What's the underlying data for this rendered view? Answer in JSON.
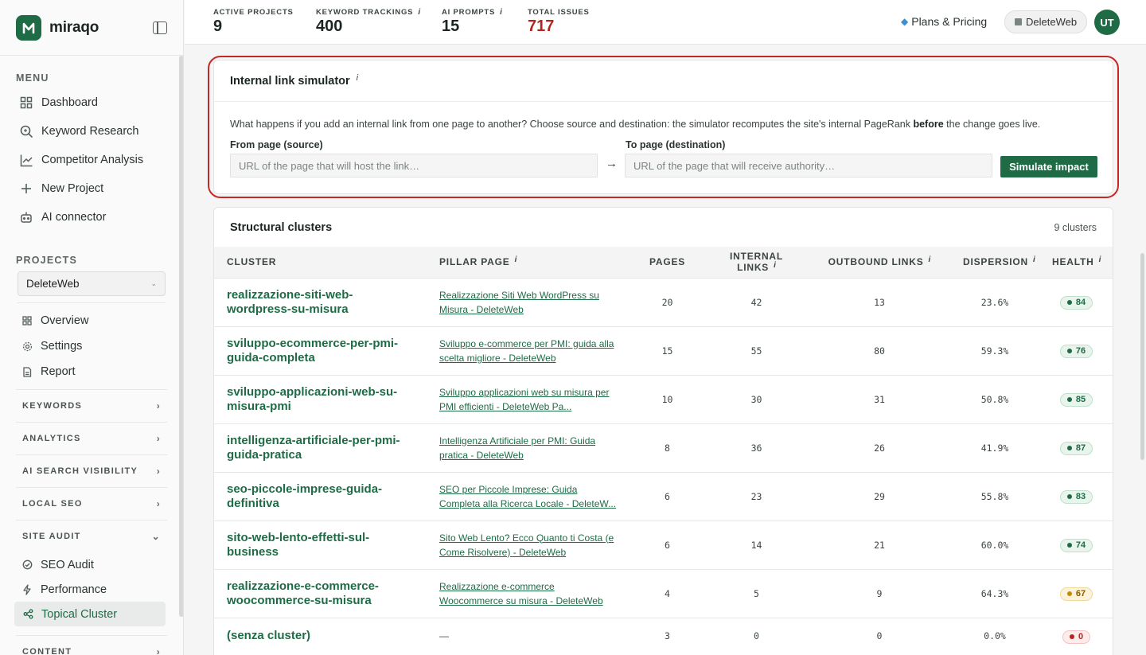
{
  "brand": {
    "name": "miraqo"
  },
  "sidebar": {
    "menu_label": "MENU",
    "menu": [
      {
        "label": "Dashboard",
        "icon": "grid-icon"
      },
      {
        "label": "Keyword Research",
        "icon": "search-icon"
      },
      {
        "label": "Competitor Analysis",
        "icon": "chart-line-icon"
      },
      {
        "label": "New Project",
        "icon": "plus-icon"
      },
      {
        "label": "AI connector",
        "icon": "robot-icon"
      }
    ],
    "projects_label": "PROJECTS",
    "project_select": "DeleteWeb",
    "project_items": [
      {
        "label": "Overview",
        "icon": "grid-icon"
      },
      {
        "label": "Settings",
        "icon": "gear-icon"
      },
      {
        "label": "Report",
        "icon": "document-icon"
      }
    ],
    "groups": {
      "keywords": "KEYWORDS",
      "analytics": "ANALYTICS",
      "ai_visibility": "AI SEARCH VISIBILITY",
      "local_seo": "LOCAL SEO",
      "site_audit": "SITE AUDIT",
      "content": "CONTENT"
    },
    "site_audit_items": [
      {
        "label": "SEO Audit",
        "icon": "check-icon"
      },
      {
        "label": "Performance",
        "icon": "bolt-icon"
      },
      {
        "label": "Topical Cluster",
        "icon": "share-nodes-icon"
      }
    ]
  },
  "topbar": {
    "stats": [
      {
        "label": "ACTIVE PROJECTS",
        "value": "9",
        "info": ""
      },
      {
        "label": "KEYWORD TRACKINGS",
        "value": "400",
        "info": "i"
      },
      {
        "label": "AI PROMPTS",
        "value": "15",
        "info": "i"
      },
      {
        "label": "TOTAL ISSUES",
        "value": "717",
        "info": ""
      }
    ],
    "plans": "Plans & Pricing",
    "project_chip": "DeleteWeb",
    "avatar": "UT"
  },
  "simulator": {
    "title": "Internal link simulator",
    "info": "i",
    "desc_before": "What happens if you add an internal link from one page to another? Choose source and destination: the simulator recomputes the site's internal PageRank ",
    "desc_bold": "before",
    "desc_after": " the change goes live.",
    "from_label": "From page (source)",
    "from_placeholder": "URL of the page that will host the link…",
    "arrow": "→",
    "to_label": "To page (destination)",
    "to_placeholder": "URL of the page that will receive authority…",
    "button": "Simulate impact"
  },
  "clusters": {
    "title": "Structural clusters",
    "count": "9 clusters",
    "columns": {
      "cluster": "CLUSTER",
      "pillar": "PILLAR PAGE",
      "pages": "PAGES",
      "internal": "INTERNAL LINKS",
      "outbound": "OUTBOUND LINKS",
      "dispersion": "DISPERSION",
      "health": "HEALTH",
      "info": "i"
    },
    "rows": [
      {
        "name": "realizzazione-siti-web-wordpress-su-misura",
        "pillar": "Realizzazione Siti Web WordPress su Misura - DeleteWeb",
        "pages": "20",
        "internal": "42",
        "outbound": "13",
        "dispersion": "23.6%",
        "health": "84",
        "tone": "green"
      },
      {
        "name": "sviluppo-ecommerce-per-pmi-guida-completa",
        "pillar": "Sviluppo e-commerce per PMI: guida alla scelta migliore - DeleteWeb",
        "pages": "15",
        "internal": "55",
        "outbound": "80",
        "dispersion": "59.3%",
        "health": "76",
        "tone": "green"
      },
      {
        "name": "sviluppo-applicazioni-web-su-misura-pmi",
        "pillar": "Sviluppo applicazioni web su misura per PMI efficienti - DeleteWeb Pa...",
        "pages": "10",
        "internal": "30",
        "outbound": "31",
        "dispersion": "50.8%",
        "health": "85",
        "tone": "green"
      },
      {
        "name": "intelligenza-artificiale-per-pmi-guida-pratica",
        "pillar": "Intelligenza Artificiale per PMI: Guida pratica - DeleteWeb",
        "pages": "8",
        "internal": "36",
        "outbound": "26",
        "dispersion": "41.9%",
        "health": "87",
        "tone": "green"
      },
      {
        "name": "seo-piccole-imprese-guida-definitiva",
        "pillar": "SEO per Piccole Imprese: Guida Completa alla Ricerca Locale - DeleteW...",
        "pages": "6",
        "internal": "23",
        "outbound": "29",
        "dispersion": "55.8%",
        "health": "83",
        "tone": "green"
      },
      {
        "name": "sito-web-lento-effetti-sul-business",
        "pillar": "Sito Web Lento? Ecco Quanto ti Costa (e Come Risolvere) - DeleteWeb",
        "pages": "6",
        "internal": "14",
        "outbound": "21",
        "dispersion": "60.0%",
        "health": "74",
        "tone": "green"
      },
      {
        "name": "realizzazione-e-commerce-woocommerce-su-misura",
        "pillar": "Realizzazione e-commerce Woocommerce su misura - DeleteWeb",
        "pages": "4",
        "internal": "5",
        "outbound": "9",
        "dispersion": "64.3%",
        "health": "67",
        "tone": "amber"
      },
      {
        "name": "(senza cluster)",
        "pillar": "—",
        "pages": "3",
        "internal": "0",
        "outbound": "0",
        "dispersion": "0.0%",
        "health": "0",
        "tone": "red"
      }
    ]
  },
  "colors": {
    "brand": "#1e6b46",
    "issues": "#b3261e",
    "highlight": "#c62828"
  }
}
